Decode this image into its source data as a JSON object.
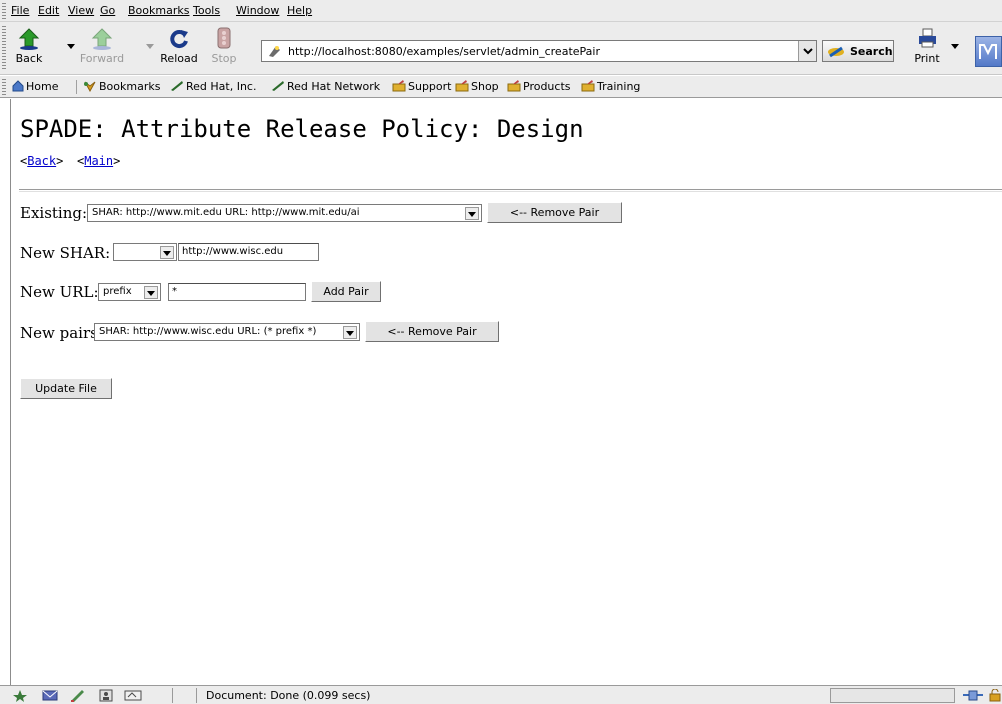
{
  "menu": [
    "File",
    "Edit",
    "View",
    "Go",
    "Bookmarks",
    "Tools",
    "Window",
    "Help"
  ],
  "toolbar": {
    "back": "Back",
    "forward": "Forward",
    "reload": "Reload",
    "stop": "Stop",
    "url": "http://localhost:8080/examples/servlet/admin_createPair",
    "search": "Search",
    "print": "Print"
  },
  "personal_toolbar": [
    {
      "label": "Home",
      "icon": "home-icon"
    },
    {
      "label": "Bookmarks",
      "icon": "bookmarks-icon"
    },
    {
      "label": "Red Hat, Inc.",
      "icon": "redhat-icon"
    },
    {
      "label": "Red Hat Network",
      "icon": "redhat-icon"
    },
    {
      "label": "Support",
      "icon": "folder-icon"
    },
    {
      "label": "Shop",
      "icon": "folder-icon"
    },
    {
      "label": "Products",
      "icon": "folder-icon"
    },
    {
      "label": "Training",
      "icon": "folder-icon"
    }
  ],
  "page": {
    "title": "SPADE: Attribute Release Policy: Design",
    "back_link": "Back",
    "main_link": "Main",
    "existing": {
      "label": "Existing:",
      "selected": "SHAR: http://www.mit.edu URL: http://www.mit.edu/ai",
      "button": "<-- Remove Pair"
    },
    "new_shar": {
      "label": "New SHAR:",
      "select_value": "",
      "input_value": "http://www.wisc.edu"
    },
    "new_url": {
      "label": "New URL:",
      "select_value": "prefix",
      "input_value": "*",
      "button": "Add Pair"
    },
    "new_pairs": {
      "label": "New pairs",
      "selected": "SHAR: http://www.wisc.edu URL: (* prefix *)",
      "button": "<-- Remove Pair"
    },
    "update_button": "Update File"
  },
  "status": {
    "text": "Document: Done (0.099 secs)"
  },
  "colors": {
    "chrome": "#ececec",
    "link": "#0000cc",
    "redhat": "#c8102e"
  }
}
